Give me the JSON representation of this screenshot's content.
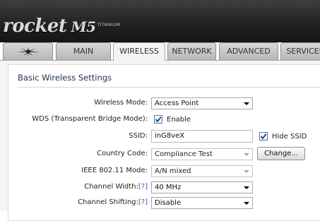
{
  "header": {
    "logo_word": "rocket",
    "logo_model": "M5",
    "logo_sub": "TITANIUM"
  },
  "tabs": [
    {
      "label": "",
      "icon": "ubiquiti-logo-icon",
      "active": false
    },
    {
      "label": "MAIN",
      "active": false
    },
    {
      "label": "WIRELESS",
      "active": true
    },
    {
      "label": "NETWORK",
      "active": false
    },
    {
      "label": "ADVANCED",
      "active": false
    },
    {
      "label": "SERVICES",
      "active": false
    }
  ],
  "section": {
    "title": "Basic Wireless Settings"
  },
  "form": {
    "wireless_mode": {
      "label": "Wireless Mode:",
      "value": "Access Point"
    },
    "wds": {
      "label": "WDS (Transparent Bridge Mode):",
      "checked": true,
      "option_label": "Enable"
    },
    "ssid": {
      "label": "SSID:",
      "value": "inG8veX",
      "hide_label": "Hide SSID",
      "hide_checked": true
    },
    "country_code": {
      "label": "Country Code:",
      "value": "Compliance Test",
      "button_label": "Change..."
    },
    "ieee_mode": {
      "label": "IEEE 802.11 Mode:",
      "value": "A/N mixed"
    },
    "channel_width": {
      "label": "Channel Width:",
      "help": "[?]",
      "value": "40 MHz"
    },
    "channel_shifting": {
      "label": "Channel Shifting:",
      "help": "[?]",
      "value": "Disable"
    }
  },
  "colors": {
    "header_bg": "#232323",
    "section_title": "#1e2f4a",
    "help_link": "#2e5fae",
    "checkmark": "#1d3f7a"
  }
}
